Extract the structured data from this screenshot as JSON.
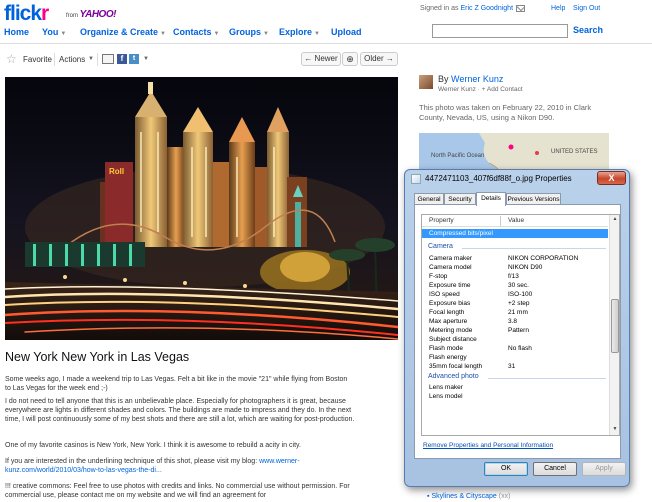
{
  "header": {
    "logo_main": "flick",
    "logo_accent": "r",
    "from_text": "from",
    "yahoo": "YAHOO!",
    "signed_in_prefix": "Signed in as",
    "username": "Eric Z Goodnight",
    "links": [
      "Help",
      "Sign Out"
    ]
  },
  "nav": {
    "items": [
      "Home",
      "You",
      "Organize & Create",
      "Contacts",
      "Groups",
      "Explore",
      "Upload"
    ],
    "search_label": "Search",
    "search_placeholder": ""
  },
  "toolbar": {
    "favorite": "Favorite",
    "actions": "Actions",
    "newer": "← Newer",
    "older": "Older →"
  },
  "photo": {
    "title": "New York New York in Las Vegas",
    "paragraphs": [
      "Some weeks ago, I made a weekend trip to Las Vegas. Felt a bit like in the movie \"21\" while flying from Boston to Las Vegas for the week end ;-)",
      "I do not need to tell anyone that this is an unbelievable place. Especially for photographers it is great, because everywhere are lights in different shades and colors. The buildings are made to impress and they do. In the next time, I will post continuously some of my best shots and there are still a lot, which are waiting for post-production.",
      "One of my favorite casinos is New York, New York. I think it is awesome to rebuild a acity in city.",
      "If you are interested in the underlining technique of this shot, please visit my blog:",
      "!!! creative commons: Feel free to use photos with credits and links. No commercial use without permission. For commercial use, please contact me on my website and we will find an agreement for"
    ],
    "blog_link": "www.werner-kunz.com/world/2010/03/how-to-las-vegas-the-di..."
  },
  "sidebar": {
    "by": "By",
    "author": "Werner Kunz",
    "author_sub": "Werner Kunz",
    "add_contact": "+ Add Contact",
    "taken_text": "This photo was taken on February 22, 2010 in Clark County, Nevada, US, using a Nikon D90.",
    "map_labels": [
      "North Pacific Ocean",
      "UNITED STATES"
    ],
    "tag_link": "Skylines & Cityscape",
    "tag_count": "(xx)"
  },
  "dialog": {
    "title": "4472471103_407f6df88f_o.jpg Properties",
    "close": "X",
    "tabs": [
      "General",
      "Security",
      "Details",
      "Previous Versions"
    ],
    "active_tab": "Details",
    "columns": [
      "Property",
      "Value"
    ],
    "selected_row": "Compressed bits/pixel",
    "groups": [
      "Camera",
      "Advanced photo"
    ],
    "camera_rows": [
      {
        "k": "Camera maker",
        "v": "NIKON CORPORATION"
      },
      {
        "k": "Camera model",
        "v": "NIKON D90"
      },
      {
        "k": "F-stop",
        "v": "f/13"
      },
      {
        "k": "Exposure time",
        "v": "30 sec."
      },
      {
        "k": "ISO speed",
        "v": "ISO-100"
      },
      {
        "k": "Exposure bias",
        "v": "+2 step"
      },
      {
        "k": "Focal length",
        "v": "21 mm"
      },
      {
        "k": "Max aperture",
        "v": "3.8"
      },
      {
        "k": "Metering mode",
        "v": "Pattern"
      },
      {
        "k": "Subject distance",
        "v": ""
      },
      {
        "k": "Flash mode",
        "v": "No flash"
      },
      {
        "k": "Flash energy",
        "v": ""
      },
      {
        "k": "35mm focal length",
        "v": "31"
      }
    ],
    "advanced_rows": [
      {
        "k": "Lens maker",
        "v": ""
      },
      {
        "k": "Lens model",
        "v": ""
      }
    ],
    "remove_link": "Remove Properties and Personal Information",
    "buttons": {
      "ok": "OK",
      "cancel": "Cancel",
      "apply": "Apply"
    }
  }
}
